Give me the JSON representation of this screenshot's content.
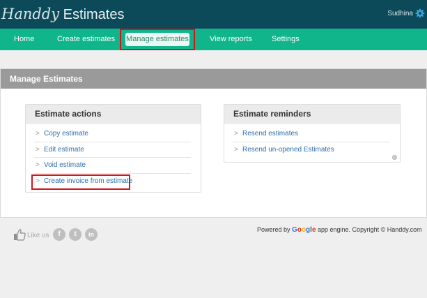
{
  "app": {
    "logo_script": "Handdy",
    "logo_plain": "Estimates",
    "user": "Sudhina",
    "settings_icon": "gear-icon"
  },
  "nav": {
    "items": [
      {
        "label": "Home"
      },
      {
        "label": "Create estimates"
      },
      {
        "label": "Manage estimates",
        "active": true
      },
      {
        "label": "View reports"
      },
      {
        "label": "Settings"
      }
    ]
  },
  "page": {
    "title": "Manage Estimates"
  },
  "estimate_actions": {
    "title": "Estimate actions",
    "items": [
      {
        "label": "Copy estimate"
      },
      {
        "label": "Edit estimate"
      },
      {
        "label": "Void estimate"
      },
      {
        "label": "Create invoice from estimate",
        "highlighted": true
      }
    ]
  },
  "estimate_reminders": {
    "title": "Estimate reminders",
    "items": [
      {
        "label": "Resend estimates"
      },
      {
        "label": "Resend un-opened Estimates"
      }
    ]
  },
  "footer": {
    "like_us": "Like us",
    "social": [
      {
        "icon": "facebook-icon",
        "glyph": "f"
      },
      {
        "icon": "twitter-icon",
        "glyph": "t"
      },
      {
        "icon": "linkedin-icon",
        "glyph": "in"
      }
    ],
    "powered_prefix": "Powered by",
    "google_letters": [
      "G",
      "o",
      "o",
      "g",
      "l",
      "e"
    ],
    "google_colors": [
      "#3b73d9",
      "#d93025",
      "#f2b400",
      "#3b73d9",
      "#188038",
      "#d93025"
    ],
    "powered_suffix": "app engine. Copyright © Handdy.com"
  },
  "colors": {
    "topbar": "#0c4a5a",
    "navbar": "#10b58c",
    "link": "#2d6ea8",
    "highlight": "#d0151b"
  }
}
